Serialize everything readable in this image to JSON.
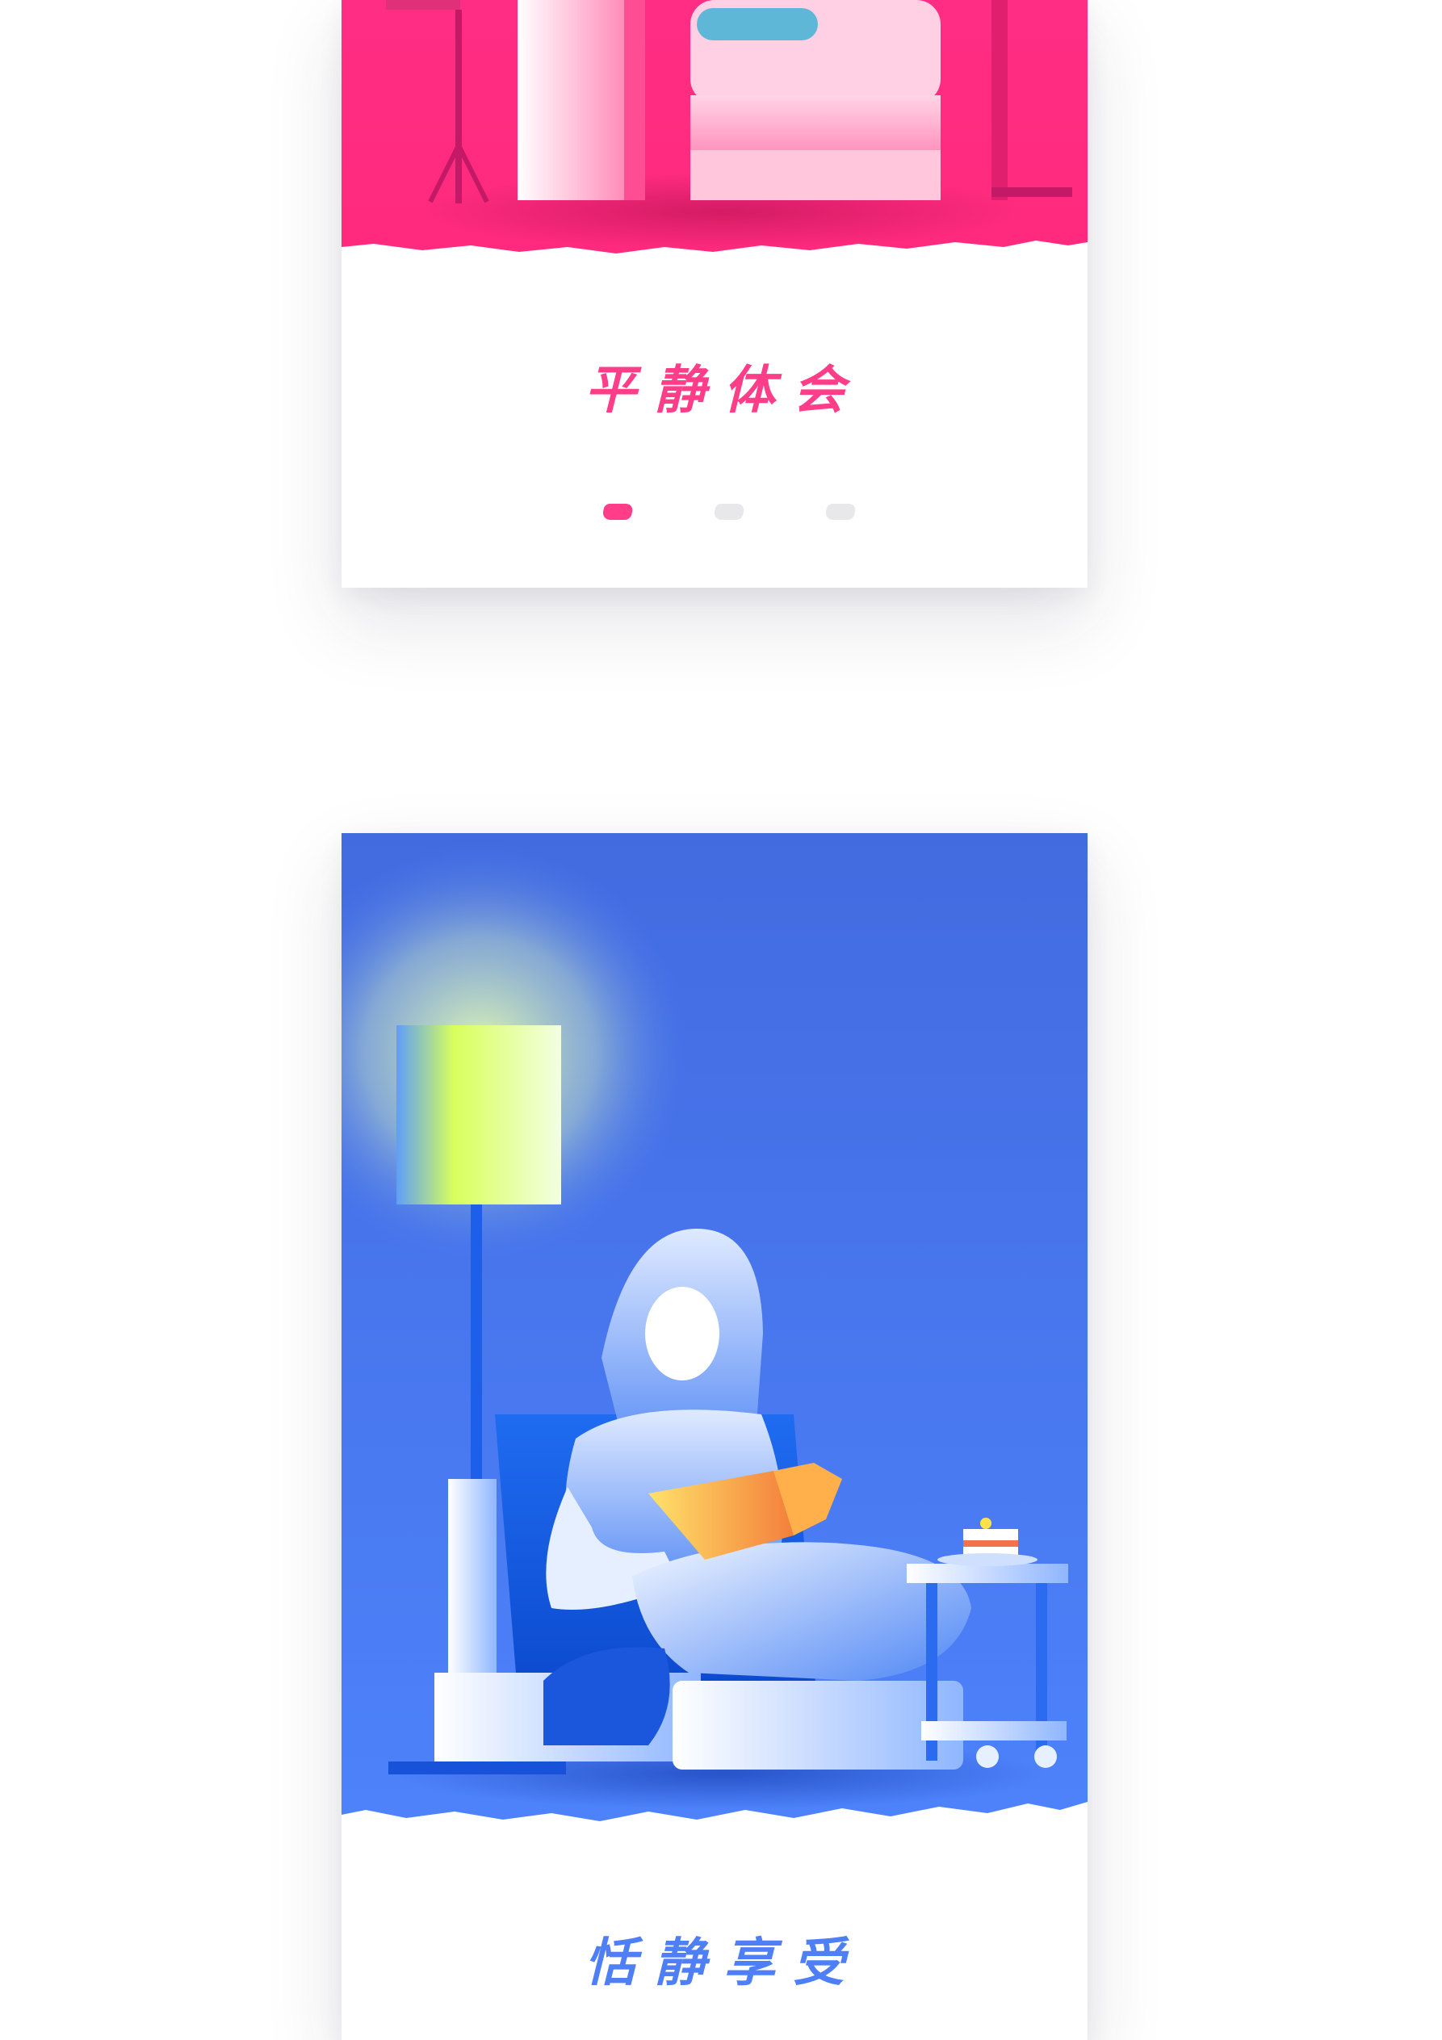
{
  "screens": [
    {
      "title": "平静体会",
      "accent": "#ff3d88",
      "pagination": {
        "active_index": 0,
        "dots": [
          {
            "state": "active",
            "color": "#ff3d88"
          },
          {
            "state": "inactive",
            "color": "#e8e8ea"
          },
          {
            "state": "inactive",
            "color": "#e8e8ea"
          }
        ]
      },
      "illustration": "floor-lamp-sofa-icon"
    },
    {
      "title": "恬静享受",
      "accent": "#4f7ff7",
      "illustration": "woman-reading-armchair-icon"
    }
  ]
}
